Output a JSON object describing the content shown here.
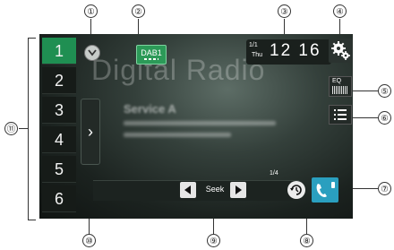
{
  "callouts": [
    "①",
    "②",
    "③",
    "④",
    "⑤",
    "⑥",
    "⑦",
    "⑧",
    "⑨",
    "⑩",
    "⑪"
  ],
  "presets": [
    "1",
    "2",
    "3",
    "4",
    "5",
    "6"
  ],
  "active_preset": "1",
  "background_text": "Digital Radio",
  "band": {
    "label": "DAB1"
  },
  "service": {
    "name": "Service A"
  },
  "clock": {
    "date_top": "1/1",
    "date_bottom": "Thu",
    "time": "12 16"
  },
  "eq": {
    "label": "EQ"
  },
  "seek": {
    "label": "Seek"
  },
  "page_indicator": "1/4",
  "icons": {
    "expand": "chevron-down-icon",
    "next_page": "chevron-right-icon",
    "settings": "gears-icon",
    "eq": "equalizer-icon",
    "list": "list-icon",
    "seek_prev": "triangle-left-icon",
    "seek_next": "triangle-right-icon",
    "recall": "history-icon",
    "phone": "phone-icon"
  },
  "colors": {
    "active_green": "#1f8f52",
    "band_green": "#2c9a58",
    "phone_blue": "#2a9fbf"
  }
}
